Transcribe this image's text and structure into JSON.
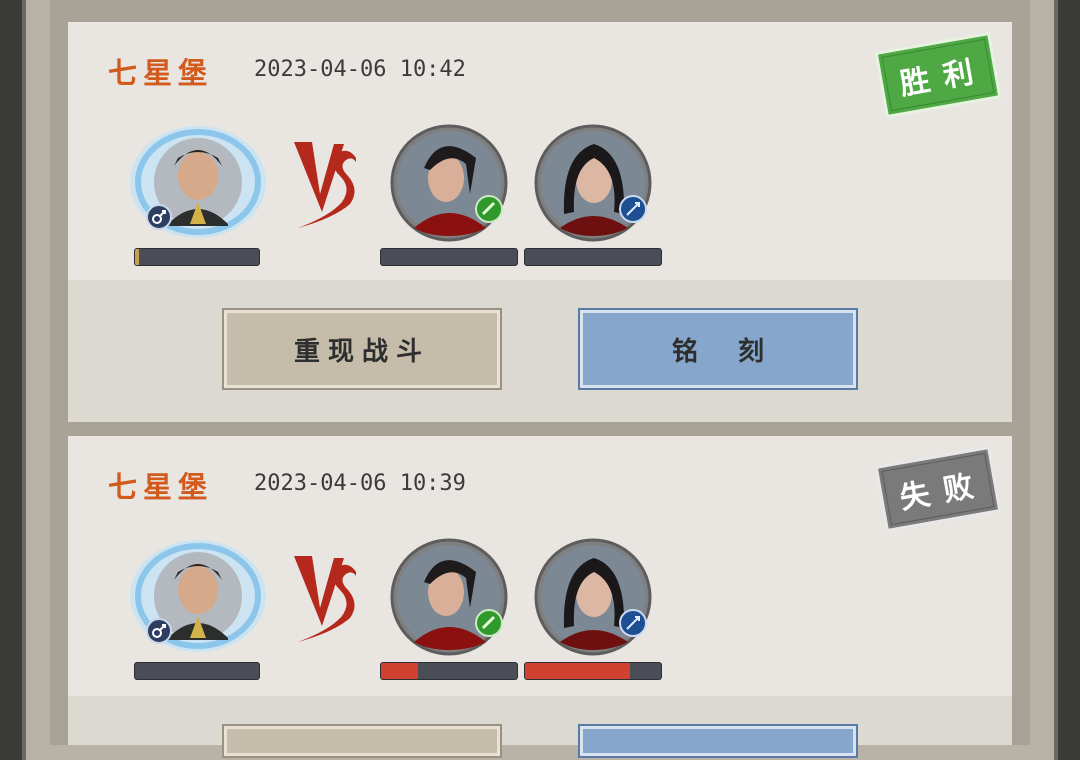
{
  "battle_log": [
    {
      "location": "七星堡",
      "timestamp": "2023-04-06  10:42",
      "result": "胜利",
      "result_color": "#4ea843",
      "vs_text": "VS",
      "player": {
        "gender_icon": "male-icon",
        "hp_fraction": 0.03
      },
      "enemies": [
        {
          "badge_icon": "green-orb-icon",
          "hp_fraction": 0.0
        },
        {
          "badge_icon": "blue-sword-icon",
          "hp_fraction": 0.0
        }
      ],
      "buttons": {
        "replay": "重现战斗",
        "inscribe": "铭刻"
      }
    },
    {
      "location": "七星堡",
      "timestamp": "2023-04-06  10:39",
      "result": "失败",
      "result_color": "#7a7a7a",
      "vs_text": "VS",
      "player": {
        "gender_icon": "male-icon",
        "hp_fraction": 0.0
      },
      "enemies": [
        {
          "badge_icon": "green-orb-icon",
          "hp_fraction": 0.27
        },
        {
          "badge_icon": "blue-sword-icon",
          "hp_fraction": 0.77
        }
      ],
      "buttons": {
        "replay": "",
        "inscribe": ""
      }
    }
  ],
  "colors": {
    "location": "#d25a1c",
    "hp_red": "#d2412f",
    "hp_gold": "#c8a052",
    "hp_empty": "#4a4d55"
  }
}
